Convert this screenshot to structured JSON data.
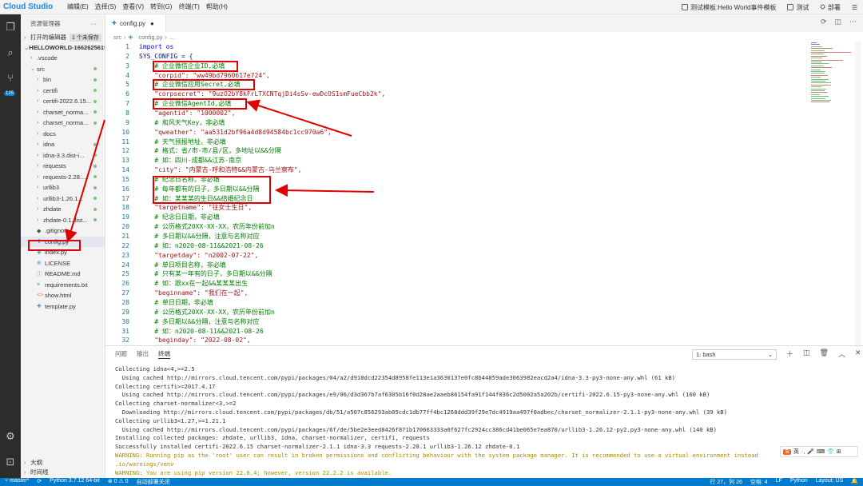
{
  "titlebar": {
    "brand": "Cloud Studio",
    "menu": [
      "编辑(E)",
      "选择(S)",
      "查看(V)",
      "转到(G)",
      "终端(T)",
      "帮助(H)"
    ],
    "template": "测试模板:Hello World事件模板",
    "test": "测试",
    "deploy": "部署"
  },
  "activity": {
    "scm_badge": "125"
  },
  "sidebar": {
    "title": "资源管理器",
    "more": "···",
    "open_editors": "打开的编辑器",
    "unsaved": "1 个未保存",
    "workspace": "HELLOWORLD-1662625619",
    "items": [
      {
        "label": ".vscode",
        "kind": "folder",
        "depth": 1,
        "chev": "›",
        "dot": false
      },
      {
        "label": "src",
        "kind": "folder",
        "depth": 1,
        "chev": "⌄",
        "dot": true
      },
      {
        "label": "bin",
        "kind": "folder",
        "depth": 2,
        "chev": "›",
        "dot": true
      },
      {
        "label": "certifi",
        "kind": "folder",
        "depth": 2,
        "chev": "›",
        "dot": true
      },
      {
        "label": "certifi-2022.6.15...",
        "kind": "folder",
        "depth": 2,
        "chev": "›",
        "dot": true
      },
      {
        "label": "charset_norma...",
        "kind": "folder",
        "depth": 2,
        "chev": "›",
        "dot": true
      },
      {
        "label": "charset_norma...",
        "kind": "folder",
        "depth": 2,
        "chev": "›",
        "dot": true
      },
      {
        "label": "docs",
        "kind": "folder",
        "depth": 2,
        "chev": "›",
        "dot": false
      },
      {
        "label": "idna",
        "kind": "folder",
        "depth": 2,
        "chev": "›",
        "dot": true
      },
      {
        "label": "idna-3.3.dist-i...",
        "kind": "folder",
        "depth": 2,
        "chev": "›",
        "dot": true
      },
      {
        "label": "requests",
        "kind": "folder",
        "depth": 2,
        "chev": "›",
        "dot": true
      },
      {
        "label": "requests-2.28....",
        "kind": "folder",
        "depth": 2,
        "chev": "›",
        "dot": true
      },
      {
        "label": "urllib3",
        "kind": "folder",
        "depth": 2,
        "chev": "›",
        "dot": true
      },
      {
        "label": "urllib3-1.26.1...",
        "kind": "folder",
        "depth": 2,
        "chev": "›",
        "dot": true
      },
      {
        "label": "zhdate",
        "kind": "folder",
        "depth": 2,
        "chev": "›",
        "dot": true
      },
      {
        "label": "zhdate-0.1.dist...",
        "kind": "folder",
        "depth": 2,
        "chev": "›",
        "dot": true
      },
      {
        "label": ".gitignore",
        "kind": "git",
        "depth": 1,
        "chev": "",
        "dot": false
      },
      {
        "label": "config.py",
        "kind": "py",
        "depth": 1,
        "chev": "",
        "dot": false,
        "selected": true
      },
      {
        "label": "index.py",
        "kind": "py",
        "depth": 1,
        "chev": "",
        "dot": false
      },
      {
        "label": "LICENSE",
        "kind": "lic",
        "depth": 1,
        "chev": "",
        "dot": false
      },
      {
        "label": "README.md",
        "kind": "md",
        "depth": 1,
        "chev": "",
        "dot": false
      },
      {
        "label": "requirements.txt",
        "kind": "txt",
        "depth": 1,
        "chev": "",
        "dot": false
      },
      {
        "label": "show.html",
        "kind": "html",
        "depth": 1,
        "chev": "",
        "dot": false
      },
      {
        "label": "template.py",
        "kind": "py",
        "depth": 1,
        "chev": "",
        "dot": false
      }
    ],
    "outline": "大纲",
    "timeline": "时间线"
  },
  "editor": {
    "tab_label": "config.py",
    "tab_dirty": "●",
    "breadcrumb_root": "src",
    "breadcrumb_file": "config.py",
    "breadcrumb_more": "...",
    "lines": [
      {
        "n": "1",
        "text": "import os",
        "cls": "kw"
      },
      {
        "n": "2",
        "text": "SYS_CONFIG = {",
        "cls": "tx"
      },
      {
        "n": "3",
        "text": "    # 企业微信企业ID,必填",
        "cls": "cm"
      },
      {
        "n": "4",
        "text": "    \"corpid\": \"ww49bd7960617e724\",",
        "cls": "st"
      },
      {
        "n": "5",
        "text": "    # 企业微信应用Secret,必填",
        "cls": "cm"
      },
      {
        "n": "6",
        "text": "    \"corpsecret\": \"9uzO2bY8kFrLTXCNTqjDi4sSv-ewDcOS1smFueCbb2k\",",
        "cls": "st"
      },
      {
        "n": "7",
        "text": "    # 企业微信AgentId,必填",
        "cls": "cm"
      },
      {
        "n": "8",
        "text": "    \"agentid\": \"1000002\",",
        "cls": "st"
      },
      {
        "n": "9",
        "text": "    # 和风天气Key，非必填",
        "cls": "cm"
      },
      {
        "n": "10",
        "text": "    \"qweather\": \"aa531d2bf96a4d8d94584bc1cc970a6\",",
        "cls": "st"
      },
      {
        "n": "11",
        "text": "    # 天气预报地址，非必填",
        "cls": "cm"
      },
      {
        "n": "12",
        "text": "    # 格式：省/市-市/县/区，多地址以&&分隔",
        "cls": "cm"
      },
      {
        "n": "13",
        "text": "    # 如：四川-成都&&江苏-南京",
        "cls": "cm"
      },
      {
        "n": "14",
        "text": "    \"city\": \"内蒙古-呼和浩特&&内蒙古-乌兰察布\",",
        "cls": "st"
      },
      {
        "n": "15",
        "text": "    # 纪念日名称，非必填",
        "cls": "cm"
      },
      {
        "n": "16",
        "text": "    # 每年都有的日子，多日期以&&分隔",
        "cls": "cm"
      },
      {
        "n": "17",
        "text": "    # 如：某某某的生日&&结婚纪念日",
        "cls": "cm"
      },
      {
        "n": "18",
        "text": "    \"targetname\": \"往女士生日\",",
        "cls": "st"
      },
      {
        "n": "19",
        "text": "    # 纪念日日期，非必填",
        "cls": "cm"
      },
      {
        "n": "20",
        "text": "    # 公历格式20XX-XX-XX，农历年份前加n",
        "cls": "cm"
      },
      {
        "n": "21",
        "text": "    # 多日期以&&分隔，注意与名称对应",
        "cls": "cm"
      },
      {
        "n": "22",
        "text": "    # 如：n2020-08-11&&2021-08-26",
        "cls": "cm"
      },
      {
        "n": "23",
        "text": "    \"targetday\": \"n2002-07-22\",",
        "cls": "st"
      },
      {
        "n": "24",
        "text": "    # 单日项目名称，非必填",
        "cls": "cm"
      },
      {
        "n": "25",
        "text": "    # 只有某一年有的日子，多日期以&&分隔",
        "cls": "cm"
      },
      {
        "n": "26",
        "text": "    # 如：跟xx在一起&&某某某出生",
        "cls": "cm"
      },
      {
        "n": "27",
        "text": "    \"beginname\": \"我们在一起\",",
        "cls": "st"
      },
      {
        "n": "28",
        "text": "    # 单日日期，非必填",
        "cls": "cm"
      },
      {
        "n": "29",
        "text": "    # 公历格式20XX-XX-XX，农历年份前加n",
        "cls": "cm"
      },
      {
        "n": "30",
        "text": "    # 多日期以&&分隔，注意与名称对应",
        "cls": "cm"
      },
      {
        "n": "31",
        "text": "    # 如：n2020-08-11&&2021-08-26",
        "cls": "cm"
      },
      {
        "n": "32",
        "text": "    \"beginday\": \"2022-08-02\",",
        "cls": "st"
      }
    ]
  },
  "panel": {
    "tabs": [
      "问题",
      "输出",
      "终端"
    ],
    "active_tab": 2,
    "terminal_select": "1: bash",
    "terminal_lines": [
      {
        "text": "Collecting idna<4,>=2.5",
        "warn": false
      },
      {
        "text": "  Using cached http://mirrors.cloud.tencent.com/pypi/packages/04/a2/d918dcd22354d8958fe113e1a3630137e0fc8b44859ade3063982eacd2a4/idna-3.3-py3-none-any.whl (61 kB)",
        "warn": false
      },
      {
        "text": "Collecting certifi>=2017.4.17",
        "warn": false
      },
      {
        "text": "  Using cached http://mirrors.cloud.tencent.com/pypi/packages/e9/06/d3d367b7af6305b16f0d28ae2aaeb86154fa91f144f036c2d5002a5a202b/certifi-2022.6.15-py3-none-any.whl (160 kB)",
        "warn": false
      },
      {
        "text": "Collecting charset-normalizer<3,>=2",
        "warn": false
      },
      {
        "text": "  Downloading http://mirrors.cloud.tencent.com/pypi/packages/db/51/a507c856293ab05cdc1db77ff4bc1268ddd39f29e7dc4919aa497f0adbec/charset_normalizer-2.1.1-py3-none-any.whl (39 kB)",
        "warn": false
      },
      {
        "text": "Collecting urllib3<1.27,>=1.21.1",
        "warn": false
      },
      {
        "text": "  Using cached http://mirrors.cloud.tencent.com/pypi/packages/6f/de/5be2e3eed8426f871b170663333a0f627fc2924cc386cd41be065e7ea870/urllib3-1.26.12-py2.py3-none-any.whl (140 kB)",
        "warn": false
      },
      {
        "text": "Installing collected packages: zhdate, urllib3, idna, charset-normalizer, certifi, requests",
        "warn": false
      },
      {
        "text": "Successfully installed certifi-2022.6.15 charset-normalizer-2.1.1 idna-3.3 requests-2.28.1 urllib3-1.26.12 zhdate-0.1",
        "warn": false
      },
      {
        "text": "WARNING: Running pip as the 'root' user can result in broken permissions and conflicting behaviour with the system package manager. It is recommended to use a virtual environment instead",
        "warn": true
      },
      {
        "text": ".io/warnings/venv",
        "warn": true
      },
      {
        "text": "WARNING: You are using pip version 22.0.4; however, version 22.2.2 is available.",
        "warn": true
      }
    ],
    "ime_label": "英"
  },
  "statusbar": {
    "branch": "master*",
    "python": "Python 3.7.12 64-bit",
    "problems": "⊗ 0 ⚠ 0",
    "autodeploy": "自动部署关闭",
    "position": "行 27，列 26",
    "spaces": "空格: 4",
    "eol": "LF",
    "language": "Python",
    "layout": "Layout: US"
  },
  "colors": {
    "annotation": "#e00000",
    "accent": "#007acc"
  }
}
